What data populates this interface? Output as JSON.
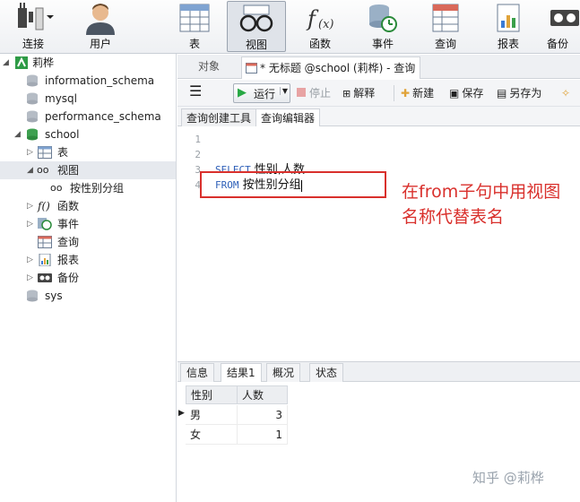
{
  "toolbar": {
    "connect": "连接",
    "user": "用户",
    "table": "表",
    "view": "视图",
    "function": "函数",
    "event": "事件",
    "query": "查询",
    "report": "报表",
    "backup": "备份"
  },
  "sidebar": {
    "connection": "莉桦",
    "databases": [
      "information_schema",
      "mysql",
      "performance_schema"
    ],
    "school": "school",
    "school_children": {
      "tables": "表",
      "views": "视图",
      "view_item": "按性别分组",
      "functions": "函数",
      "events": "事件",
      "queries": "查询",
      "reports": "报表",
      "backups": "备份"
    },
    "sys": "sys"
  },
  "tabs": {
    "objects": "对象",
    "query_tab": "* 无标题 @school (莉桦) - 查询"
  },
  "query_toolbar": {
    "run": "运行",
    "stop": "停止",
    "explain": "解释",
    "new": "新建",
    "save": "保存",
    "save_as": "另存为"
  },
  "subtabs": {
    "builder": "查询创建工具",
    "editor": "查询编辑器"
  },
  "editor": {
    "line_numbers": [
      "1",
      "2",
      "3",
      "4"
    ],
    "line3_kw": "SELECT",
    "line3_rest": " 性别,人数",
    "line4_kw": "FROM",
    "line4_rest": " 按性别分组"
  },
  "annotation": "在from子句中用视图名称代替表名",
  "result_tabs": [
    "信息",
    "结果1",
    "概况",
    "状态"
  ],
  "result": {
    "columns": [
      "性别",
      "人数"
    ],
    "rows": [
      [
        "男",
        "3"
      ],
      [
        "女",
        "1"
      ]
    ]
  },
  "watermark": "知乎 @莉桦",
  "colors": {
    "annotation": "#d9302c",
    "keyword": "#2d5fb8",
    "run_green": "#27a844"
  }
}
